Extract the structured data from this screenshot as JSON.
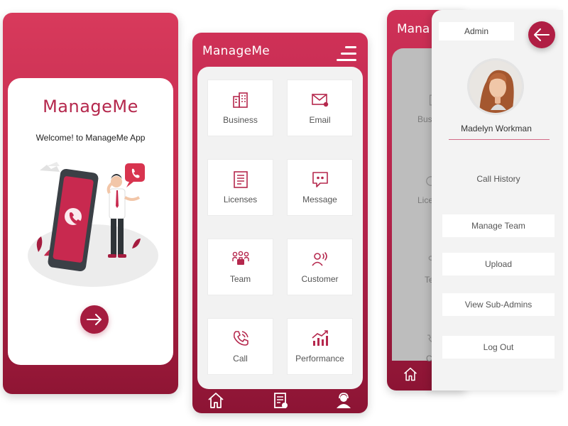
{
  "splash": {
    "logo": "ManageMe",
    "welcome": "Welcome! to ManageMe App",
    "next_icon": "arrow-right-icon"
  },
  "dashboard": {
    "logo": "ManageMe",
    "menu_icon": "hamburger-menu-icon",
    "tiles": [
      {
        "label": "Business",
        "icon": "building-icon"
      },
      {
        "label": "Email",
        "icon": "mail-icon"
      },
      {
        "label": "Licenses",
        "icon": "document-icon"
      },
      {
        "label": "Message",
        "icon": "chat-icon"
      },
      {
        "label": "Team",
        "icon": "team-icon"
      },
      {
        "label": "Customer",
        "icon": "customer-icon"
      },
      {
        "label": "Call",
        "icon": "phone-icon"
      },
      {
        "label": "Performance",
        "icon": "chart-icon"
      }
    ],
    "nav": [
      "home-icon",
      "notes-icon",
      "support-agent-icon"
    ]
  },
  "drawer": {
    "logo_partial": "Mana",
    "role": "Admin",
    "back_icon": "arrow-left-icon",
    "user_name": "Madelyn Workman",
    "items": [
      {
        "label": "Call History"
      },
      {
        "label": "Manage Team"
      },
      {
        "label": "Upload"
      },
      {
        "label": "View Sub-Admins"
      },
      {
        "label": "Log Out"
      }
    ],
    "ghost_labels": [
      "Busi",
      "Lice",
      "Te",
      "C"
    ]
  },
  "colors": {
    "primary": "#b5284d",
    "dark": "#8c1434",
    "panel": "#f2f2f2"
  }
}
